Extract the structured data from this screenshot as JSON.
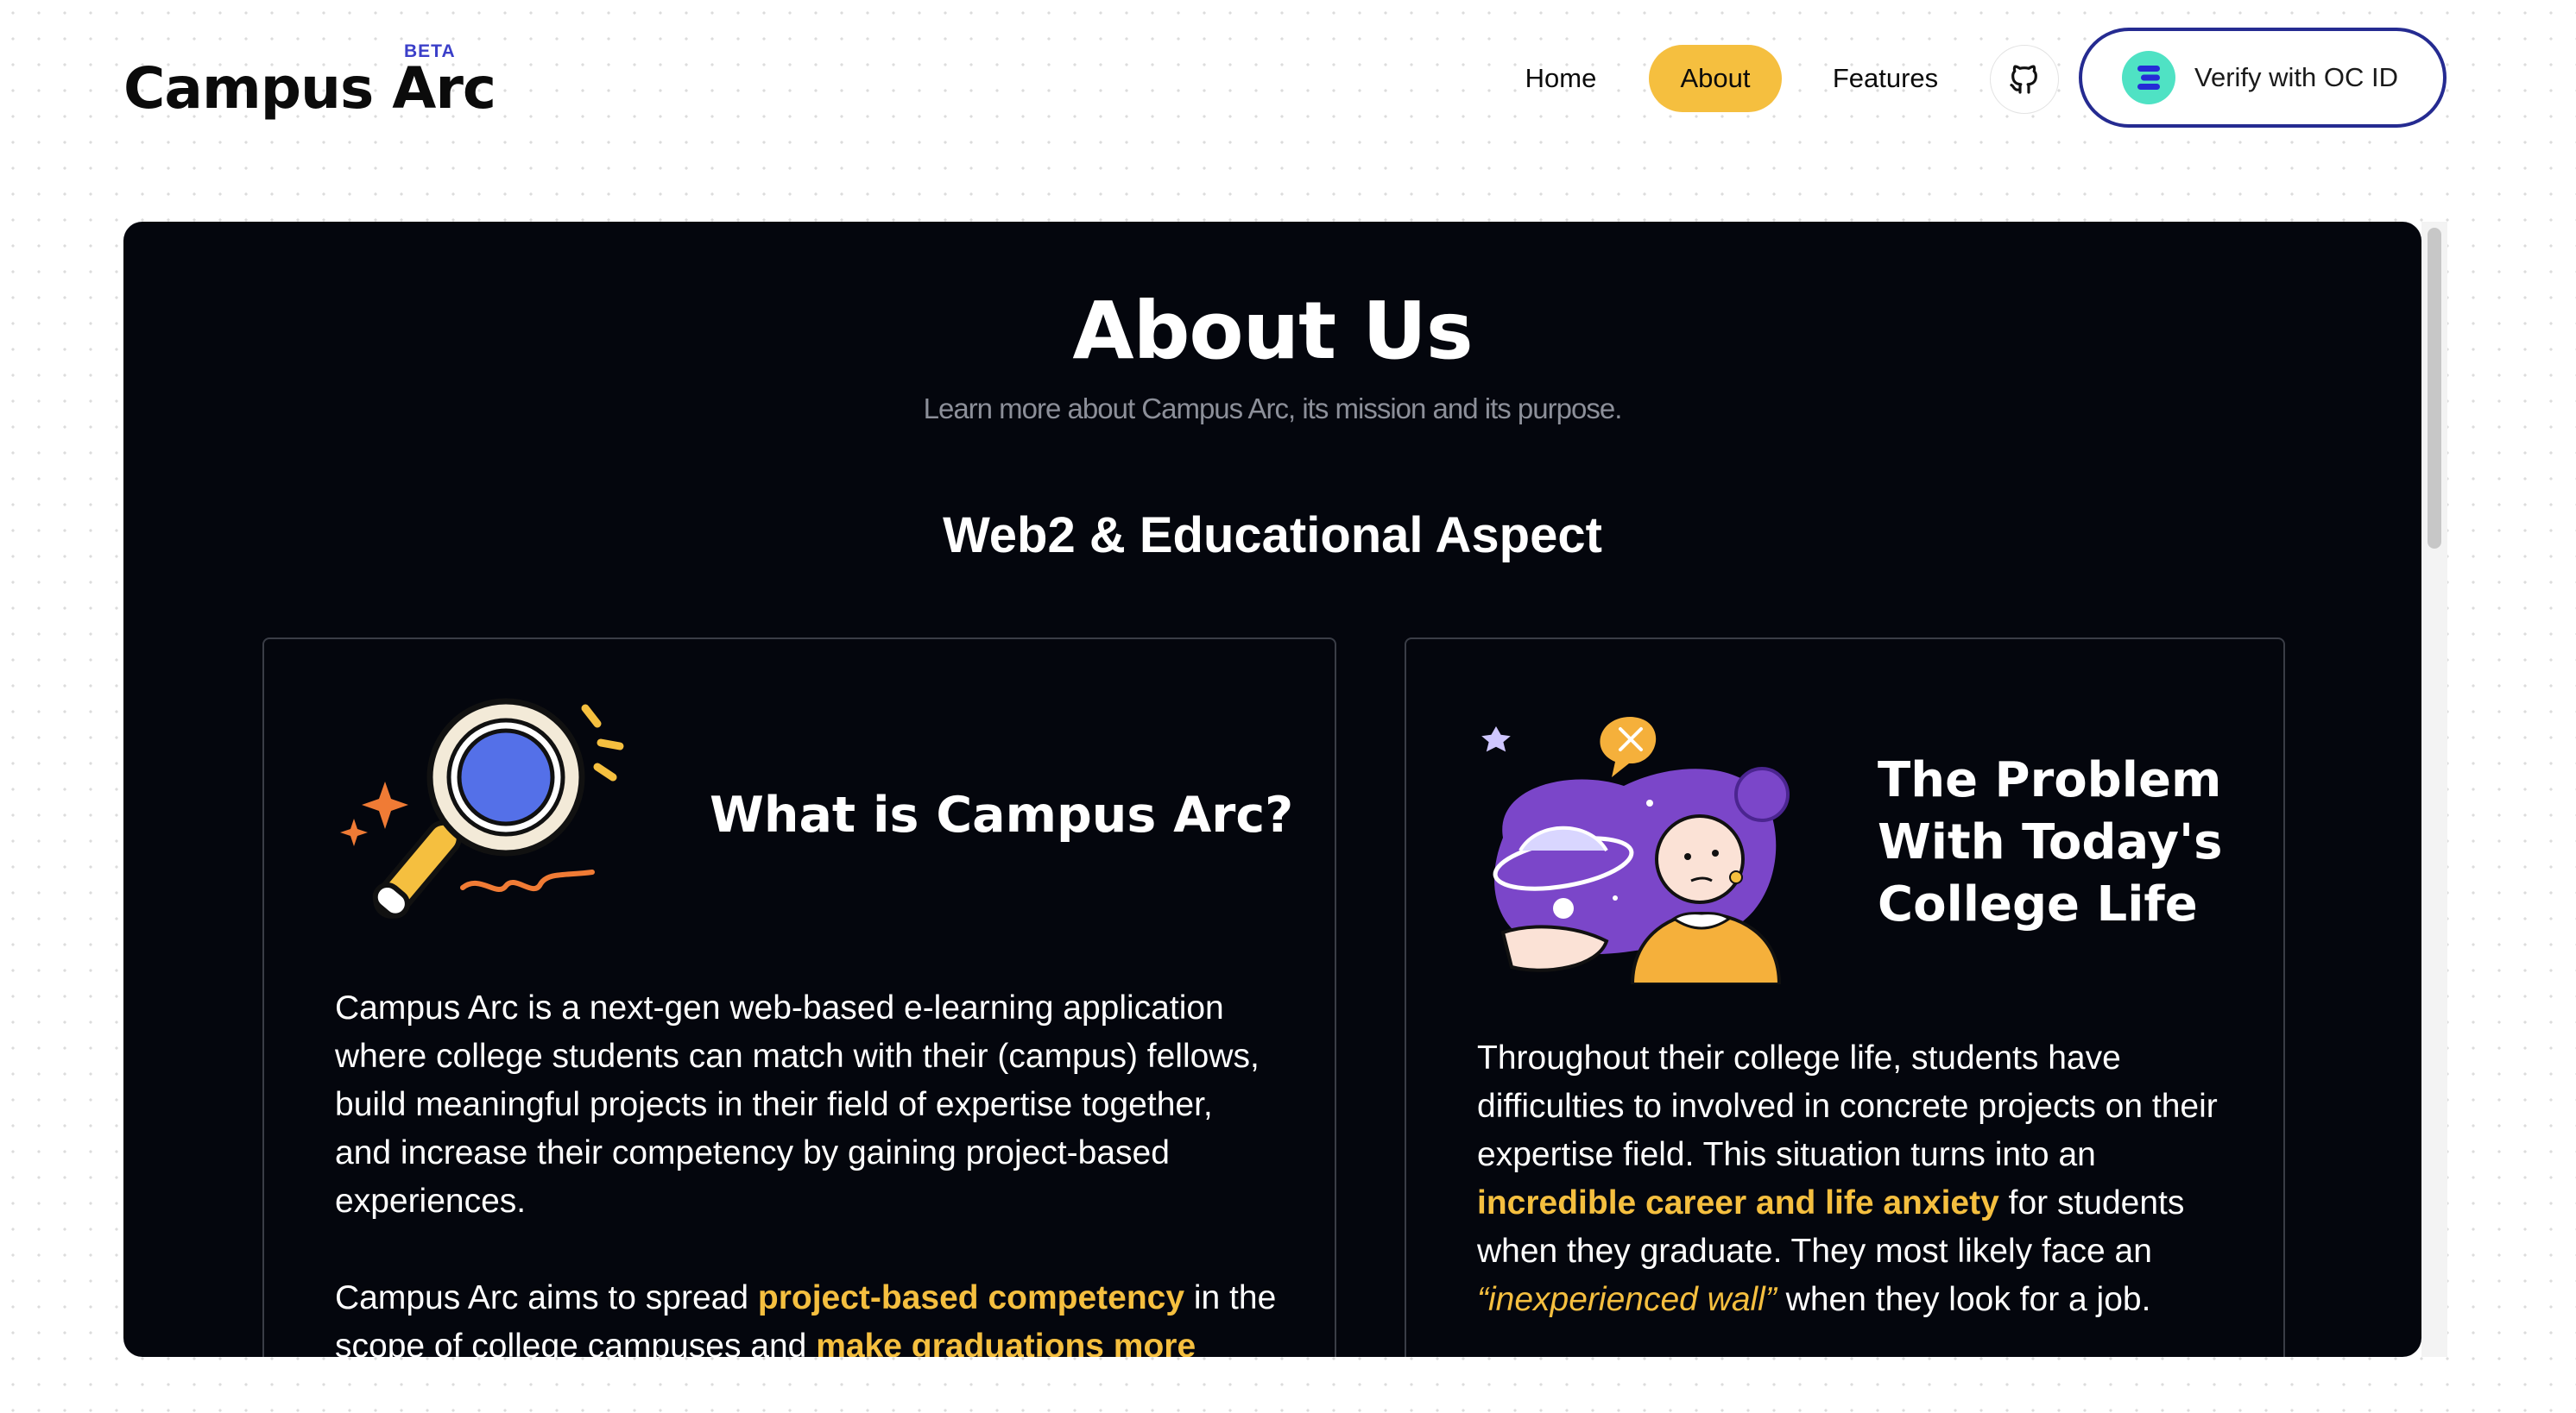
{
  "header": {
    "logo_text": "Campus Arc",
    "beta_badge": "BETA",
    "nav": [
      {
        "label": "Home",
        "active": false
      },
      {
        "label": "About",
        "active": true
      },
      {
        "label": "Features",
        "active": false
      }
    ],
    "github_icon": "github-icon",
    "verify_label": "Verify with OC ID",
    "verify_icon": "oc-id-icon"
  },
  "colors": {
    "accent": "#f5bf3f",
    "panel_bg": "#04060d",
    "verify_border": "#252b91",
    "oc_badge": "#4fe2c4",
    "beta": "#3b3fc9"
  },
  "about": {
    "title": "About Us",
    "subtitle": "Learn more about Campus Arc, its mission and its purpose.",
    "section_title": "Web2 & Educational Aspect"
  },
  "card_left": {
    "illustration": "magnifying-glass-illustration",
    "heading": "What is Campus Arc?",
    "paragraph1": "Campus Arc is a next-gen web-based e-learning application where college students can match with their (campus) fellows, build meaningful projects in their field of expertise together, and increase their competency by gaining project-based experiences.",
    "paragraph2_pre": "Campus Arc aims to spread ",
    "paragraph2_hl1": "project-based competency",
    "paragraph2_mid": " in the scope of college campuses and ",
    "paragraph2_hl2": "make graduations more"
  },
  "card_right": {
    "illustration": "anxious-student-illustration",
    "heading_line1": "The Problem",
    "heading_line2": "With Today's",
    "heading_line3": "College Life",
    "p_pre": "Throughout their college life, students have difficulties to involved in concrete projects on their expertise field. This situation turns into an ",
    "p_hl": "incredible career and life anxiety",
    "p_mid": " for students when they graduate. They most likely face an ",
    "p_quote": "“inexperienced wall”",
    "p_post": " when they look for a job."
  }
}
